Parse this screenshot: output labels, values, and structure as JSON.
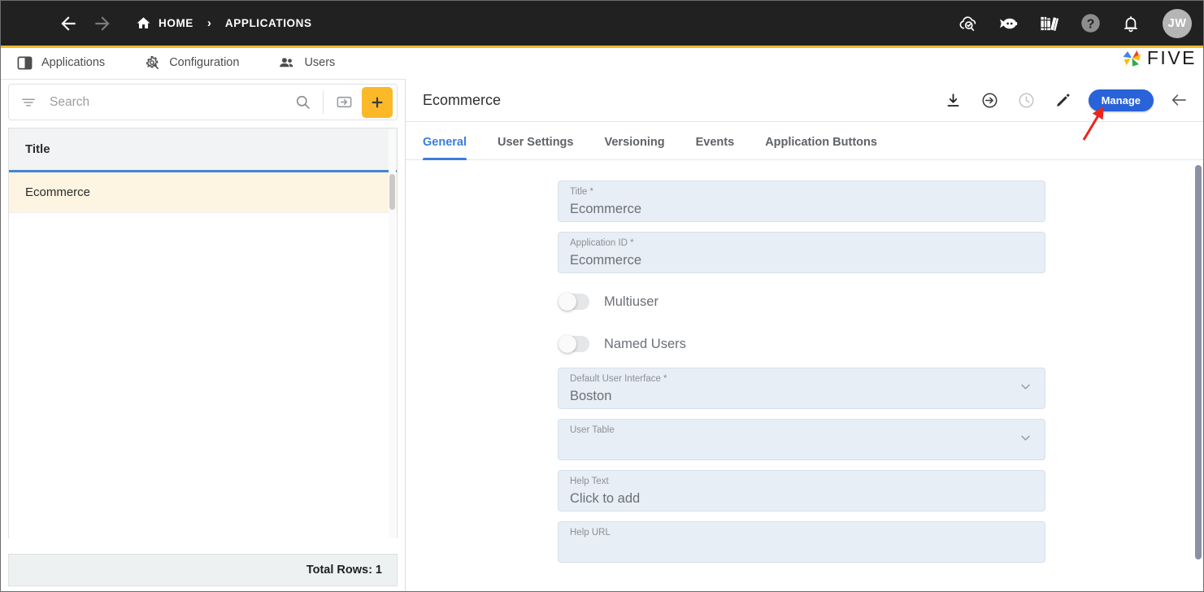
{
  "topbar": {
    "menu_icon": "hamburger-icon",
    "back_icon": "arrow-left-icon",
    "forward_icon": "arrow-right-icon",
    "home_icon": "home-icon",
    "breadcrumb": {
      "home": "HOME",
      "separator": "›",
      "current": "APPLICATIONS"
    },
    "right_icons": [
      {
        "name": "cloud-check-icon"
      },
      {
        "name": "chat-bot-icon"
      },
      {
        "name": "books-library-icon"
      },
      {
        "name": "help-icon"
      },
      {
        "name": "notifications-bell-icon"
      }
    ],
    "avatar_initials": "JW",
    "accent_rule_color": "#fbb829"
  },
  "module_tabs": [
    {
      "label": "Applications",
      "icon": "applications-icon"
    },
    {
      "label": "Configuration",
      "icon": "configuration-gear-icon"
    },
    {
      "label": "Users",
      "icon": "users-icon"
    }
  ],
  "brand": {
    "word": "FIVE",
    "icon": "five-pinwheel-logo"
  },
  "sidebar": {
    "search": {
      "placeholder": "Search",
      "value": ""
    },
    "filter_icon": "filter-icon",
    "search_icon": "search-icon",
    "import_icon": "import-arrow-icon",
    "add_icon": "plus-icon",
    "grid": {
      "columns": [
        "Title"
      ],
      "rows": [
        {
          "title": "Ecommerce",
          "selected": true
        }
      ]
    },
    "footer": {
      "total_rows_label": "Total Rows: 1"
    }
  },
  "main": {
    "title": "Ecommerce",
    "header_actions": [
      {
        "name": "download-icon"
      },
      {
        "name": "deploy-arrow-icon"
      },
      {
        "name": "history-clock-icon"
      },
      {
        "name": "edit-pencil-icon"
      }
    ],
    "manage_button": {
      "label": "Manage",
      "color": "#2962d9"
    },
    "back_icon": "arrow-left-icon",
    "tabs": [
      {
        "label": "General",
        "active": true
      },
      {
        "label": "User Settings",
        "active": false
      },
      {
        "label": "Versioning",
        "active": false
      },
      {
        "label": "Events",
        "active": false
      },
      {
        "label": "Application Buttons",
        "active": false
      }
    ],
    "form": {
      "fields": [
        {
          "type": "text",
          "label": "Title *",
          "value": "Ecommerce"
        },
        {
          "type": "text",
          "label": "Application ID *",
          "value": "Ecommerce"
        },
        {
          "type": "toggle",
          "label": "Multiuser",
          "value": "off"
        },
        {
          "type": "toggle",
          "label": "Named Users",
          "value": "off"
        },
        {
          "type": "select",
          "label": "Default User Interface *",
          "value": "Boston"
        },
        {
          "type": "select",
          "label": "User Table",
          "value": ""
        },
        {
          "type": "text",
          "label": "Help Text",
          "value": "Click to add"
        },
        {
          "type": "text",
          "label": "Help URL",
          "value": ""
        }
      ]
    }
  },
  "annotation": {
    "type": "arrow",
    "color": "#e8251f",
    "points_to": "manage-button"
  }
}
